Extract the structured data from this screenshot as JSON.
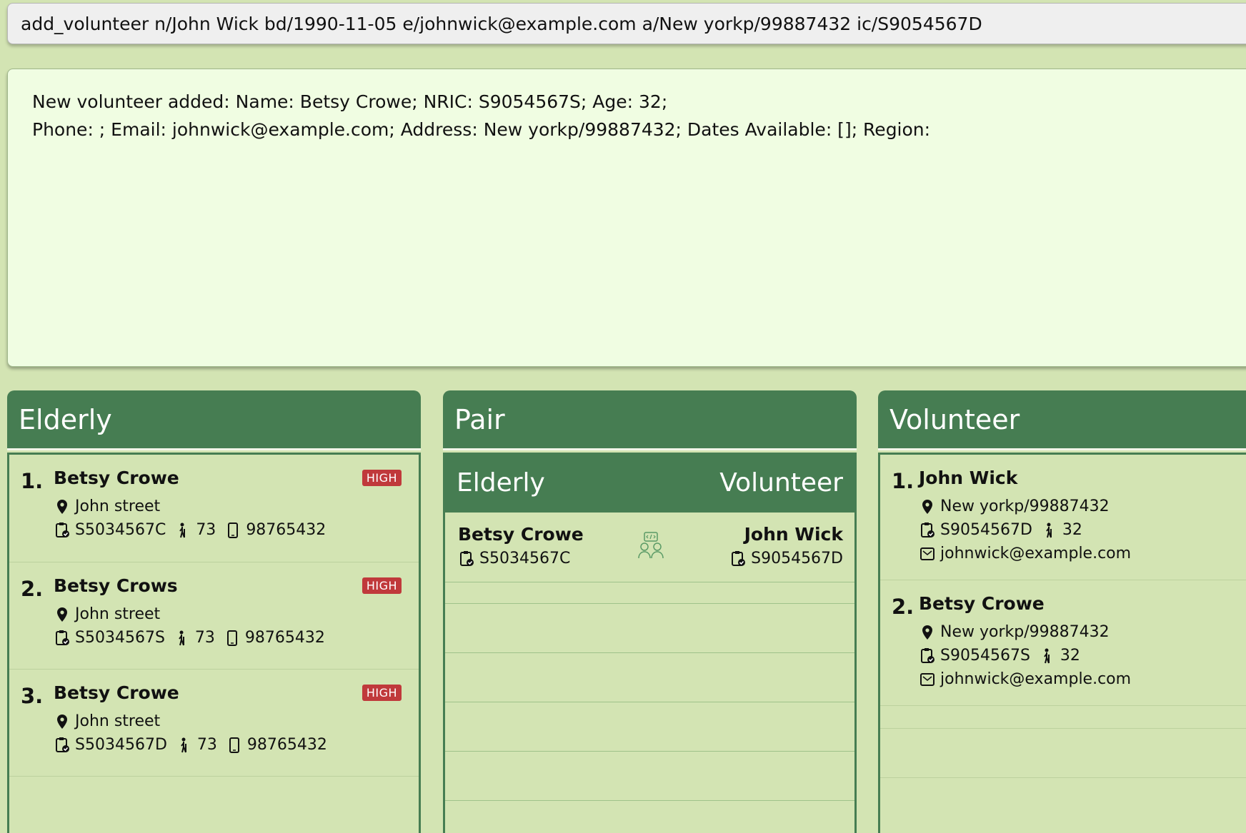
{
  "command_box": {
    "value": "add_volunteer n/John Wick bd/1990-11-05 e/johnwick@example.com a/New yorkp/99887432 ic/S9054567D"
  },
  "result_box": {
    "line1": "New volunteer added: Name: Betsy Crowe; NRIC: S9054567S; Age: 32;",
    "line2": "Phone: ; Email: johnwick@example.com; Address: New yorkp/99887432; Dates Available: []; Region:"
  },
  "elderly_panel": {
    "title": "Elderly",
    "items": [
      {
        "index": "1.",
        "name": "Betsy Crowe",
        "risk": "HIGH",
        "address": "John street",
        "nric": "S5034567C",
        "age": "73",
        "phone": "98765432"
      },
      {
        "index": "2.",
        "name": "Betsy Crows",
        "risk": "HIGH",
        "address": "John street",
        "nric": "S5034567S",
        "age": "73",
        "phone": "98765432"
      },
      {
        "index": "3.",
        "name": "Betsy Crowe",
        "risk": "HIGH",
        "address": "John street",
        "nric": "S5034567D",
        "age": "73",
        "phone": "98765432"
      }
    ]
  },
  "pair_panel": {
    "title": "Pair",
    "col_elderly": "Elderly",
    "col_volunteer": "Volunteer",
    "pairs": [
      {
        "elderly_name": "Betsy Crowe",
        "elderly_nric": "S5034567C",
        "volunteer_name": "John Wick",
        "volunteer_nric": "S9054567D"
      }
    ]
  },
  "volunteer_panel": {
    "title": "Volunteer",
    "items": [
      {
        "index": "1.",
        "name": "John Wick",
        "address": "New yorkp/99887432",
        "nric": "S9054567D",
        "age": "32",
        "email": "johnwick@example.com"
      },
      {
        "index": "2.",
        "name": "Betsy Crowe",
        "address": "New yorkp/99887432",
        "nric": "S9054567S",
        "age": "32",
        "email": "johnwick@example.com"
      }
    ]
  },
  "colors": {
    "header_green": "#467d52",
    "background": "#d3e4b3",
    "result_bg": "#f0fde2",
    "badge_red": "#c0393b"
  },
  "icons": [
    "location-pin-icon",
    "id-card-icon",
    "age-person-icon",
    "phone-icon",
    "email-icon",
    "pair-icon"
  ]
}
